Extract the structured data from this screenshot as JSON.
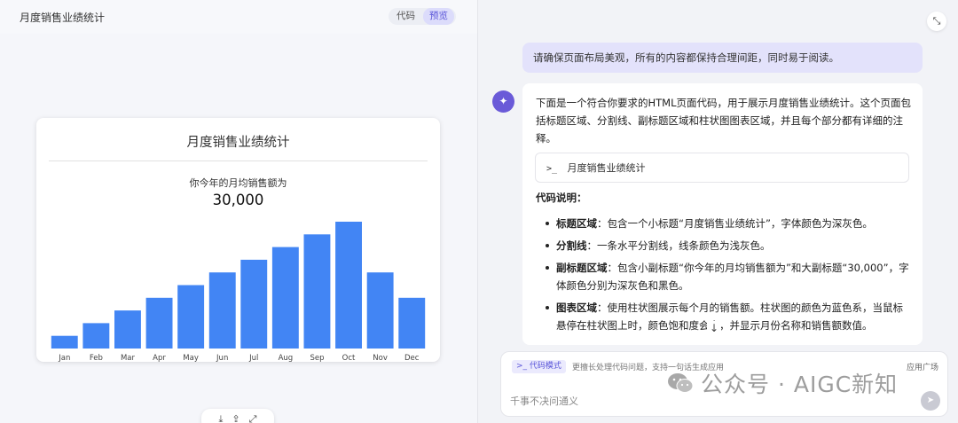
{
  "left_pane": {
    "title": "月度销售业绩统计",
    "tabs": [
      {
        "label": "代码",
        "active": false
      },
      {
        "label": "预览",
        "active": true
      }
    ],
    "card": {
      "title": "月度销售业绩统计",
      "subtitle": "你今年的月均销售额为",
      "big_value": "30,000"
    },
    "download_bar": {
      "download_icon": "download-icon",
      "share_icon": "share-icon",
      "expand_icon": "expand-icon"
    }
  },
  "chart_data": {
    "type": "bar",
    "categories": [
      "Jan",
      "Feb",
      "Mar",
      "Apr",
      "May",
      "Jun",
      "Jul",
      "Aug",
      "Sep",
      "Oct",
      "Nov",
      "Dec"
    ],
    "values": [
      10000,
      20000,
      30000,
      40000,
      50000,
      60000,
      70000,
      80000,
      90000,
      100000,
      60000,
      40000
    ],
    "bar_color": "#4285f4",
    "grid": false,
    "legend": "none",
    "ylim": [
      0,
      100000
    ]
  },
  "right_pane": {
    "collapse_icon": "collapse-icon",
    "user_message": "请确保页面布局美观，所有的内容都保持合理间距，同时易于阅读。",
    "assistant": {
      "avatar_icon": "assistant-logo-icon",
      "intro": "下面是一个符合你要求的HTML页面代码，用于展示月度销售业绩统计。这个页面包括标题区域、分割线、副标题区域和柱状图图表区域，并且每个部分都有详细的注释。",
      "code_block": {
        "prompt": ">_",
        "label": "月度销售业绩统计"
      },
      "explain_title": "代码说明：",
      "bullets": [
        {
          "term": "标题区域",
          "text": "：包含一个小标题“月度销售业绩统计”，字体颜色为深灰色。"
        },
        {
          "term": "分割线",
          "text": "：一条水平分割线，线条颜色为浅灰色。"
        },
        {
          "term": "副标题区域",
          "text": "：包含小副标题“你今年的月均销售额为”和大副标题“30,000”，字体颜色分别为深灰色和黑色。"
        },
        {
          "term": "图表区域",
          "text": "：使用柱状图展示每个月的销售额。柱状图的颜色为蓝色系，当鼠标悬停在柱状图上时，颜色饱和度会变，并显示月份名称和销售额数值。"
        }
      ],
      "scroll_down_icon": "arrow-down-icon"
    },
    "input": {
      "mode_chip": ">_ 代码模式",
      "mode_desc": "更擅长处理代码问题，支持一句话生成应用",
      "app_plaza": "应用广场",
      "placeholder": "千事不决问通义",
      "send_icon": "send-icon"
    },
    "watermark": {
      "text": "公众号 · AIGC新知",
      "logo_icon": "wechat-logo-icon"
    }
  },
  "colors": {
    "accent": "#5a55d9",
    "bar": "#4285f4",
    "user_bubble": "#e3e2fb"
  }
}
